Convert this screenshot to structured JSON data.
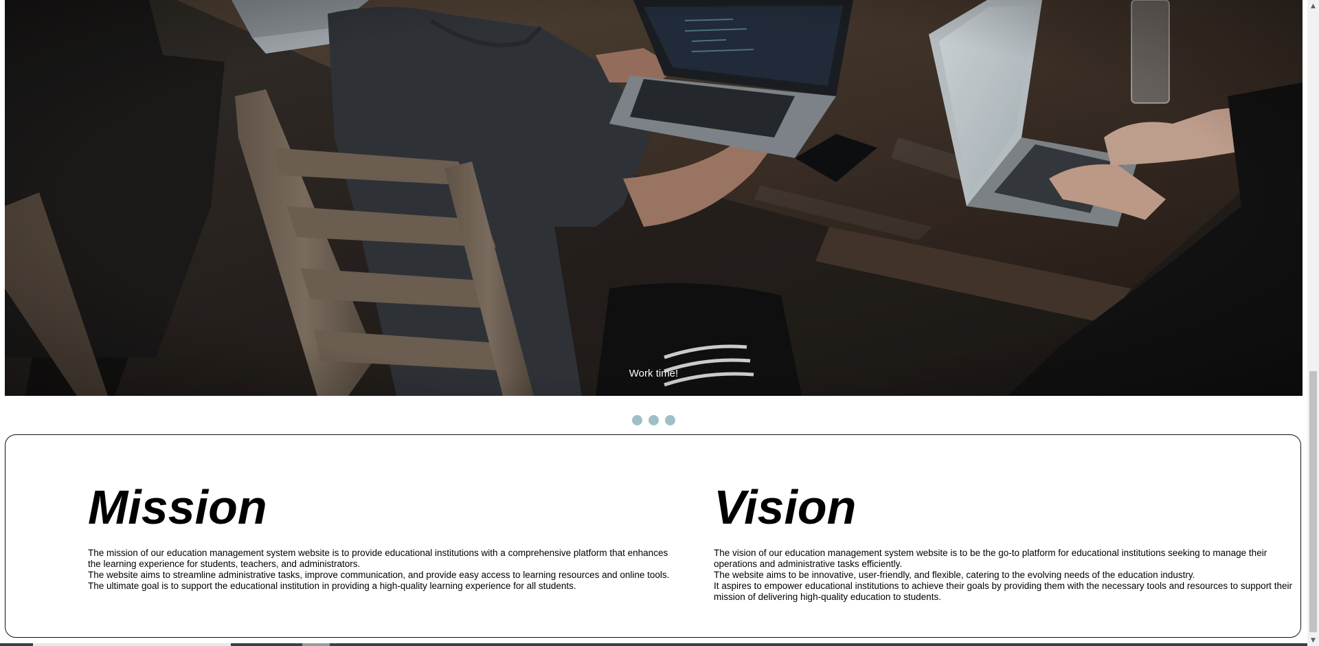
{
  "carousel": {
    "caption": "Work time!",
    "indicators": [
      "slide-1",
      "slide-2",
      "slide-3"
    ],
    "indicator_color": "#9fbfc6"
  },
  "mission": {
    "title": "Mission",
    "paragraphs": [
      "The mission of our education management system website is to provide educational institutions with a comprehensive platform that enhances the learning experience for students, teachers, and administrators.",
      "The website aims to streamline administrative tasks, improve communication, and provide easy access to learning resources and online tools.",
      "The ultimate goal is to support the educational institution in providing a high-quality learning experience for all students."
    ]
  },
  "vision": {
    "title": "Vision",
    "paragraphs": [
      "The vision of our education management system website is to be the go-to platform for educational institutions seeking to manage their operations and administrative tasks efficiently.",
      "The website aims to be innovative, user-friendly, and flexible, catering to the evolving needs of the education industry.",
      "It aspires to empower educational institutions to achieve their goals by providing them with the necessary tools and resources to support their mission of delivering high-quality education to students."
    ]
  },
  "scrollbar": {
    "up_icon": "scroll-up-arrow-icon",
    "down_icon": "scroll-down-arrow-icon"
  }
}
